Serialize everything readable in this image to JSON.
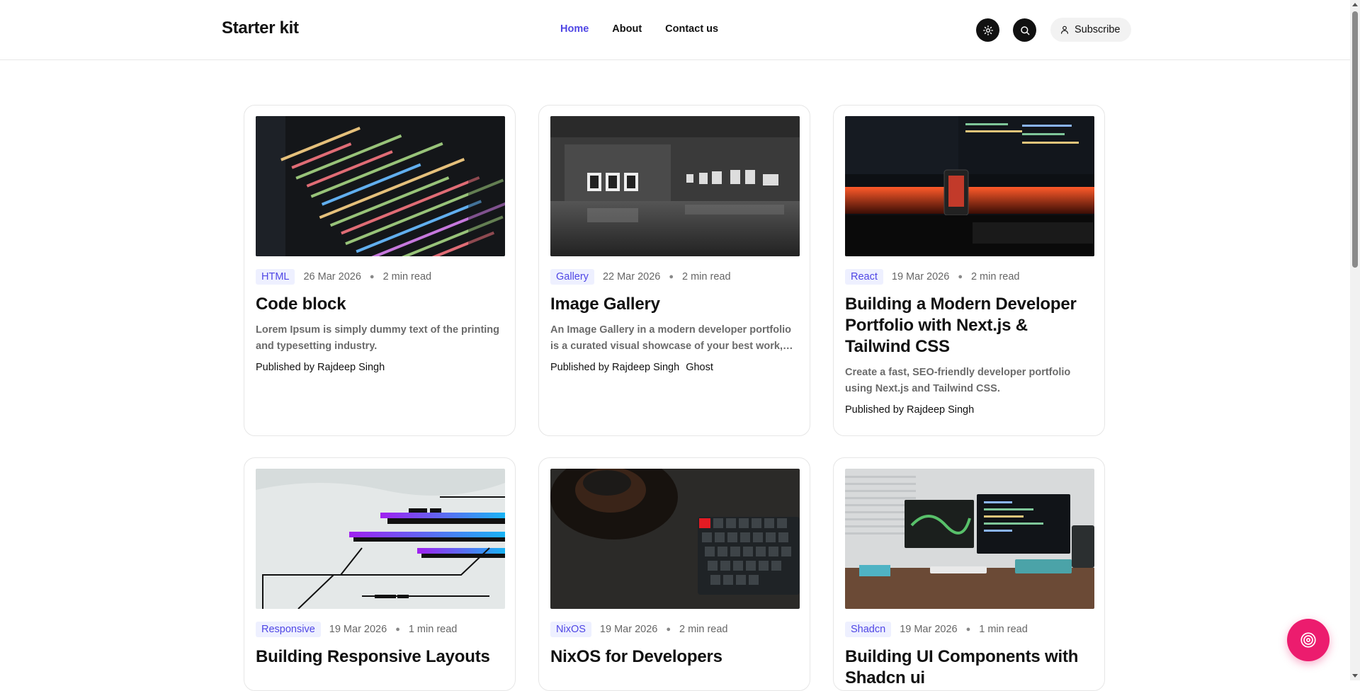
{
  "header": {
    "brand": "Starter kit",
    "nav": [
      {
        "label": "Home",
        "active": true
      },
      {
        "label": "About",
        "active": false
      },
      {
        "label": "Contact us",
        "active": false
      }
    ],
    "theme_icon": "sun-icon",
    "search_icon": "search-icon",
    "subscribe_label": "Subscribe"
  },
  "colors": {
    "accent": "#4f46e5",
    "tag_bg": "#eef0ff",
    "fab": "#ec1c6e"
  },
  "posts": [
    {
      "tag": "HTML",
      "date": "26 Mar 2026",
      "read": "2 min read",
      "title": "Code block",
      "excerpt": "Lorem Ipsum is simply dummy text of the printing and typesetting industry.",
      "authors": [
        "Published by Rajdeep Singh"
      ]
    },
    {
      "tag": "Gallery",
      "date": "22 Mar 2026",
      "read": "2 min read",
      "title": "Image Gallery",
      "excerpt": "An Image Gallery in a modern developer portfolio is a curated visual showcase of your best work,…",
      "authors": [
        "Published by Rajdeep Singh",
        "Ghost"
      ]
    },
    {
      "tag": "React",
      "date": "19 Mar 2026",
      "read": "2 min read",
      "title": "Building a Modern Developer Portfolio with Next.js & Tailwind CSS",
      "excerpt": "Create a fast, SEO-friendly developer portfolio using Next.js and Tailwind CSS.",
      "authors": [
        "Published by Rajdeep Singh"
      ]
    },
    {
      "tag": "Responsive",
      "date": "19 Mar 2026",
      "read": "1 min read",
      "title": "Building Responsive Layouts",
      "excerpt": "",
      "authors": []
    },
    {
      "tag": "NixOS",
      "date": "19 Mar 2026",
      "read": "2 min read",
      "title": "NixOS for Developers",
      "excerpt": "",
      "authors": []
    },
    {
      "tag": "Shadcn",
      "date": "19 Mar 2026",
      "read": "1 min read",
      "title": "Building UI Components with Shadcn ui",
      "excerpt": "",
      "authors": []
    }
  ],
  "fab_icon": "chat-icon"
}
